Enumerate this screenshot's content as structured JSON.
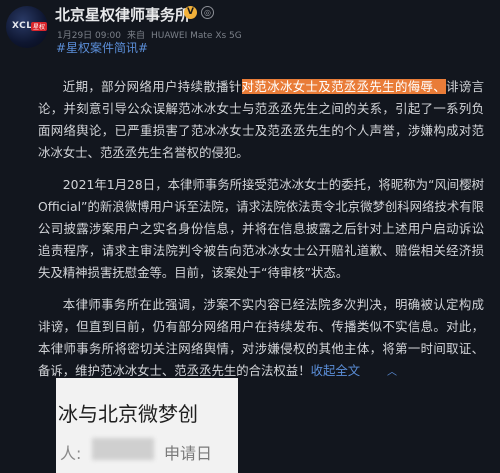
{
  "header": {
    "avatar_logo": "XCL",
    "avatar_badge": "星权",
    "author": "北京星权律师事务所",
    "verified_icon": "verified-badge-icon",
    "level_icon": "level-icon",
    "date": "1月29日 09:00",
    "source": "来自",
    "device": "HUAWEI Mate Xs 5G",
    "hashtag": "#星权案件简讯#"
  },
  "body": {
    "p1_start": "近期，部分网络用户持续散播针",
    "p1_highlight": "对范冰冰女士及范丞丞先生的侮辱、",
    "p1_end": "诽谤言论，并刻意引导公众误解范冰冰女士与范丞丞先生之间的关系，引起了一系列负面网络舆论，已严重损害了范冰冰女士及范丞丞先生的个人声誉，涉嫌构成对范冰冰女士、范丞丞先生名誉权的侵犯。",
    "p2": "2021年1月28日，本律师事务所接受范冰冰女士的委托，将昵称为“风间樱树Official”的新浪微博用户诉至法院，请求法院依法责令北京微梦创科网络技术有限公司披露涉案用户之实名身份信息，并将在信息披露之后针对上述用户启动诉讼追责程序，请求主审法院判令被告向范冰冰女士公开赔礼道歉、赔偿相关经济损失及精神损害抚慰金等。目前，该案处于“待审核”状态。",
    "p3": "本律师事务所在此强调，涉案不实内容已经法院多次判决，明确被认定构成诽谤，但直到目前，仍有部分网络用户在持续发布、传播类似不实信息。对此，本律师事务所将密切关注网络舆情，对涉嫌侵权的其他主体，将第一时间取证、备诉，维护范冰冰女士、范丞丞先生的合法权益！",
    "expand_label": "收起全文",
    "expand_icon": "chevron-up-icon"
  },
  "image": {
    "line1": "冰与北京微梦创",
    "label": "人:",
    "apply": "申请日"
  },
  "colors": {
    "background": "#12161e",
    "highlight": "#e97c38",
    "link": "#5b8ed8"
  }
}
